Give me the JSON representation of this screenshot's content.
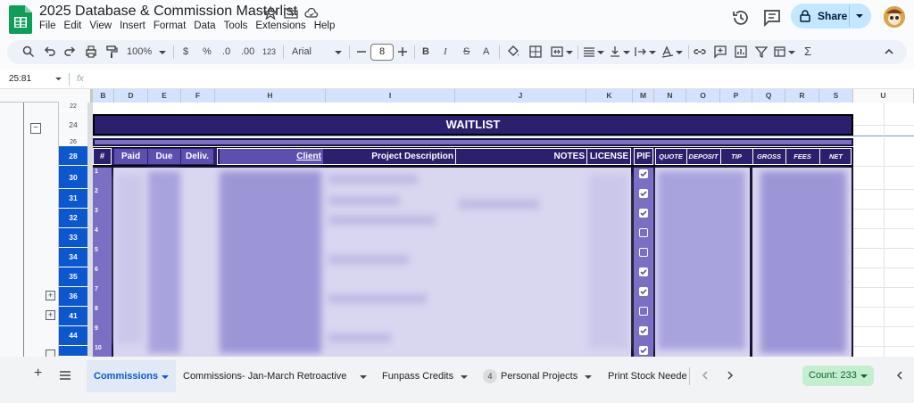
{
  "app": {
    "doc_title": "2025 Database & Commission Masterlist",
    "menu": [
      "File",
      "Edit",
      "View",
      "Insert",
      "Format",
      "Data",
      "Tools",
      "Extensions",
      "Help"
    ],
    "share_label": "Share"
  },
  "toolbar": {
    "zoom": "100%",
    "currency": "$",
    "percent": "%",
    "dec_decrease": ".0",
    "dec_increase": ".00",
    "number_format": "123",
    "font": "Arial",
    "font_size": "8",
    "bold": "B",
    "italic": "I",
    "strike": "S",
    "text_color": "A",
    "sum": "Σ"
  },
  "formula_bar": {
    "name_box": "25:81",
    "fx": "fx"
  },
  "columns": [
    "B",
    "D",
    "E",
    "F",
    "H",
    "I",
    "J",
    "K",
    "M",
    "N",
    "O",
    "P",
    "Q",
    "R",
    "S",
    "U"
  ],
  "rows": [
    "22",
    "24",
    "26",
    "28",
    "30",
    "31",
    "32",
    "33",
    "34",
    "35",
    "36",
    "41",
    "44"
  ],
  "sheet": {
    "waitlist_title": "WAITLIST",
    "headers": {
      "num": "#",
      "paid": "Paid",
      "due": "Due",
      "deliv": "Deliv.",
      "client": "Client",
      "project": "Project Description",
      "notes": "NOTES",
      "license": "LICENSE",
      "pif": "PIF",
      "quote": "QUOTE",
      "deposit": "DEPOSIT",
      "tip": "TIP",
      "gross": "GROSS",
      "fees": "FEES",
      "net": "NET"
    },
    "row_numbers": [
      "1",
      "2",
      "3",
      "4",
      "5",
      "6",
      "7",
      "8",
      "9",
      "10"
    ],
    "pif_checked": [
      true,
      true,
      true,
      false,
      false,
      true,
      true,
      false,
      true,
      true
    ]
  },
  "tabs": [
    {
      "label": "Commissions",
      "active": true
    },
    {
      "label": "Commissions- Jan-March Retroactive",
      "active": false
    },
    {
      "label": "Funpass Credits",
      "active": false
    },
    {
      "label": "Personal Projects",
      "badge": "4",
      "active": false
    },
    {
      "label": "Print Stock Neede",
      "active": false
    }
  ],
  "status": {
    "count": "Count: 233"
  },
  "colors": {
    "accent": "#0b57d0",
    "navy": "#2c1f6e",
    "lavender": "#8a7fd0",
    "share_bg": "#c2e7ff"
  }
}
